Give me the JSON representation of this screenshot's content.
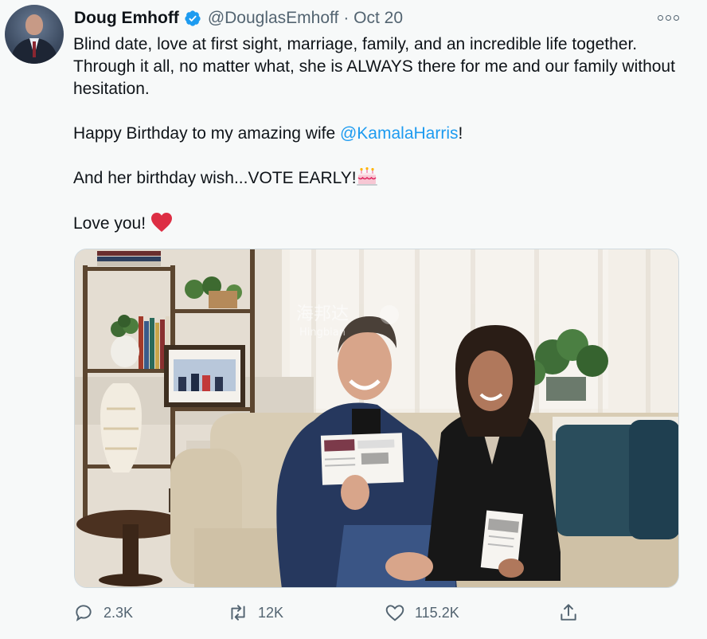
{
  "author": {
    "name": "Doug Emhoff",
    "handle": "@DouglasEmhoff",
    "date": "· Oct 20",
    "verified": true
  },
  "tweet": {
    "line1": "Blind date, love at first sight, marriage, family, and an incredible life together. Through it all, no matter what, she is ALWAYS there for me and our family without hesitation.",
    "line2_prefix": "Happy Birthday to my amazing wife ",
    "line2_mention": "@KamalaHarris",
    "line2_suffix": "!",
    "line3": "And her birthday wish...VOTE EARLY!",
    "line4": "Love you!"
  },
  "media": {
    "watermark": "海邦达",
    "watermark_latin": "Hingbian"
  },
  "actions": {
    "reply_count": "2.3K",
    "retweet_count": "12K",
    "like_count": "115.2K"
  },
  "colors": {
    "accent": "#1d9bf0",
    "text": "#0f1419",
    "muted": "#536471",
    "heart": "#e0245e"
  },
  "icons": [
    "verified-badge-icon",
    "more-options-icon",
    "birthday-cake-icon",
    "red-heart-icon",
    "reply-icon",
    "retweet-icon",
    "like-icon",
    "share-icon"
  ]
}
